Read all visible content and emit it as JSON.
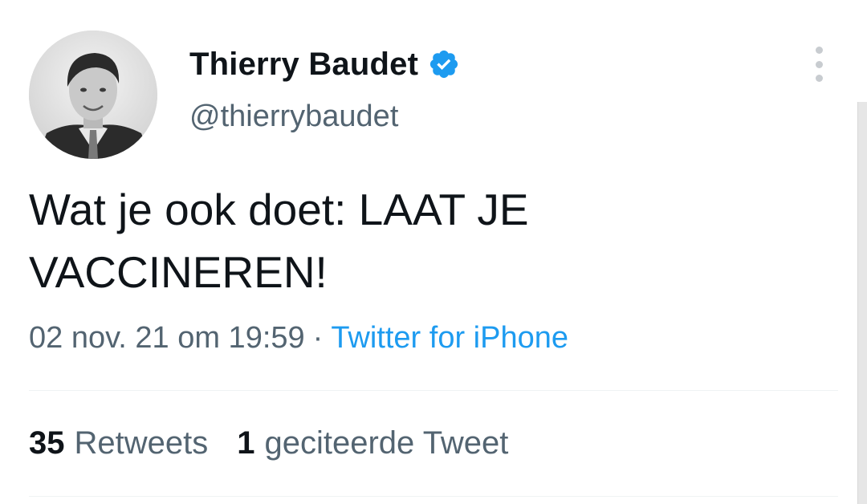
{
  "author": {
    "display_name": "Thierry Baudet",
    "handle": "@thierrybaudet",
    "verified": true,
    "verified_color": "#1d9bf0"
  },
  "tweet": {
    "text": "Wat je ook doet: LAAT JE VACCINEREN!",
    "timestamp": "02 nov. 21 om 19:59",
    "separator": "·",
    "source": "Twitter for iPhone"
  },
  "stats": {
    "retweets_count": "35",
    "retweets_label": "Retweets",
    "quotes_count": "1",
    "quotes_label": "geciteerde Tweet"
  },
  "colors": {
    "text_primary": "#0f1419",
    "text_secondary": "#536471",
    "link": "#1d9bf0",
    "divider": "#eff3f4"
  },
  "icons": {
    "verified": "verified-badge-icon",
    "more": "more-vertical-icon"
  }
}
